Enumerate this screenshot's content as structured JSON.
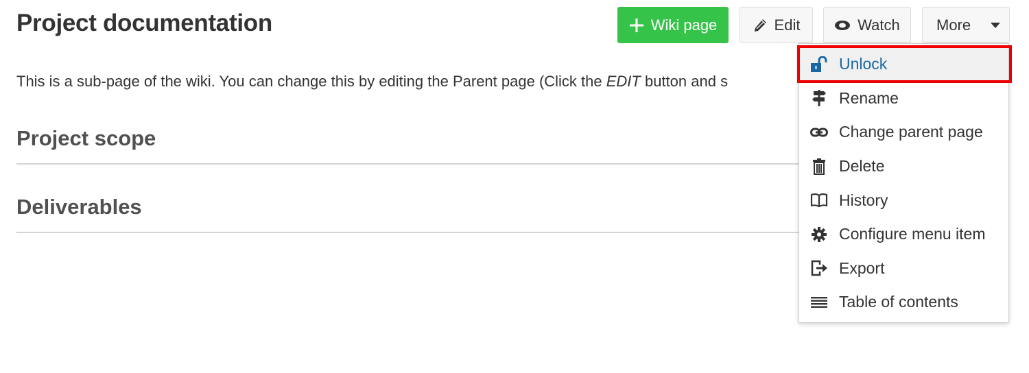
{
  "page": {
    "title": "Project documentation",
    "intro": {
      "before": "This is a sub-page of the wiki. You can change this by editing the Parent page (Click the ",
      "emphasis": "EDIT",
      "after": " button and s"
    }
  },
  "toolbar": {
    "wiki_page_label": "Wiki page",
    "edit_label": "Edit",
    "watch_label": "Watch",
    "more_label": "More"
  },
  "sections": [
    {
      "heading": "Project scope"
    },
    {
      "heading": "Deliverables"
    }
  ],
  "more_menu": {
    "items": [
      {
        "label": "Unlock",
        "icon": "unlock-icon",
        "active": true
      },
      {
        "label": "Rename",
        "icon": "signpost-icon"
      },
      {
        "label": "Change parent page",
        "icon": "link-icon"
      },
      {
        "label": "Delete",
        "icon": "trash-icon"
      },
      {
        "label": "History",
        "icon": "book-icon"
      },
      {
        "label": "Configure menu item",
        "icon": "gear-icon"
      },
      {
        "label": "Export",
        "icon": "export-icon"
      },
      {
        "label": "Table of contents",
        "icon": "list-icon"
      }
    ]
  },
  "colors": {
    "primary_button": "#35c349",
    "active_item_text": "#1a67a3",
    "highlight_border": "#ee0000"
  }
}
